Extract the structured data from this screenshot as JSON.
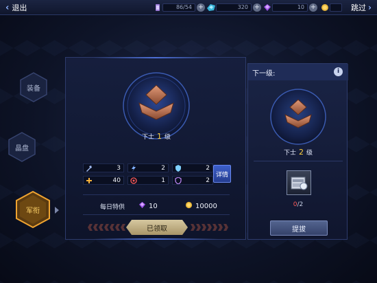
{
  "topbar": {
    "back_label": "退出",
    "skip_label": "跳过",
    "resources": [
      {
        "icon": "stamina-icon",
        "value": "86/54"
      },
      {
        "icon": "crystal-icon",
        "value": "320"
      },
      {
        "icon": "gem-icon",
        "value": "10"
      },
      {
        "icon": "gold-coin-icon",
        "value": ""
      }
    ]
  },
  "sidenav": {
    "items": [
      {
        "label": "装备",
        "active": false
      },
      {
        "label": "晶盘",
        "active": false
      },
      {
        "label": "军衔",
        "active": true
      }
    ]
  },
  "current_rank": {
    "name": "下士",
    "level": "1",
    "suffix": "级",
    "stats": [
      {
        "icon": "attack-icon",
        "value": "3"
      },
      {
        "icon": "lightning-icon",
        "value": "2"
      },
      {
        "icon": "shield-icon",
        "value": "2"
      },
      {
        "icon": "health-cross-icon",
        "value": "40"
      },
      {
        "icon": "target-icon",
        "value": "1"
      },
      {
        "icon": "armor-icon",
        "value": "2"
      }
    ],
    "detail_label": "详情",
    "daily_label": "每日特供",
    "daily_gems": "10",
    "daily_gold": "10000",
    "claimed_label": "已领取"
  },
  "next_rank": {
    "header": "下一级:",
    "name": "下士",
    "level": "2",
    "suffix": "级",
    "item_have": "0",
    "item_need": "/2",
    "promote_label": "提拔"
  },
  "colors": {
    "accent": "#3c5fcb",
    "gold": "#ffd23f",
    "warning": "#ff5a5a",
    "rank_badge": "#b4694a"
  }
}
